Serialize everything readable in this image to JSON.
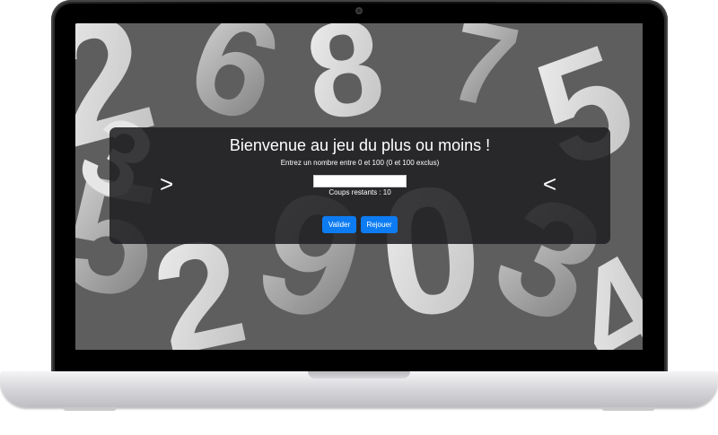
{
  "game": {
    "title": "Bienvenue au jeu du plus ou moins !",
    "instruction": "Entrez un nombre entre 0 et 100 (0 et 100 exclus)",
    "input_value": "",
    "attempts_text": "Coups restants : 10",
    "hint_left": ">",
    "hint_right": "<",
    "validate_label": "Valider",
    "replay_label": "Rejouer"
  },
  "colors": {
    "button": "#0d7cf2",
    "panel": "#212124",
    "text": "#ffffff"
  },
  "background": {
    "description_icon": "falling-numbers-background"
  }
}
